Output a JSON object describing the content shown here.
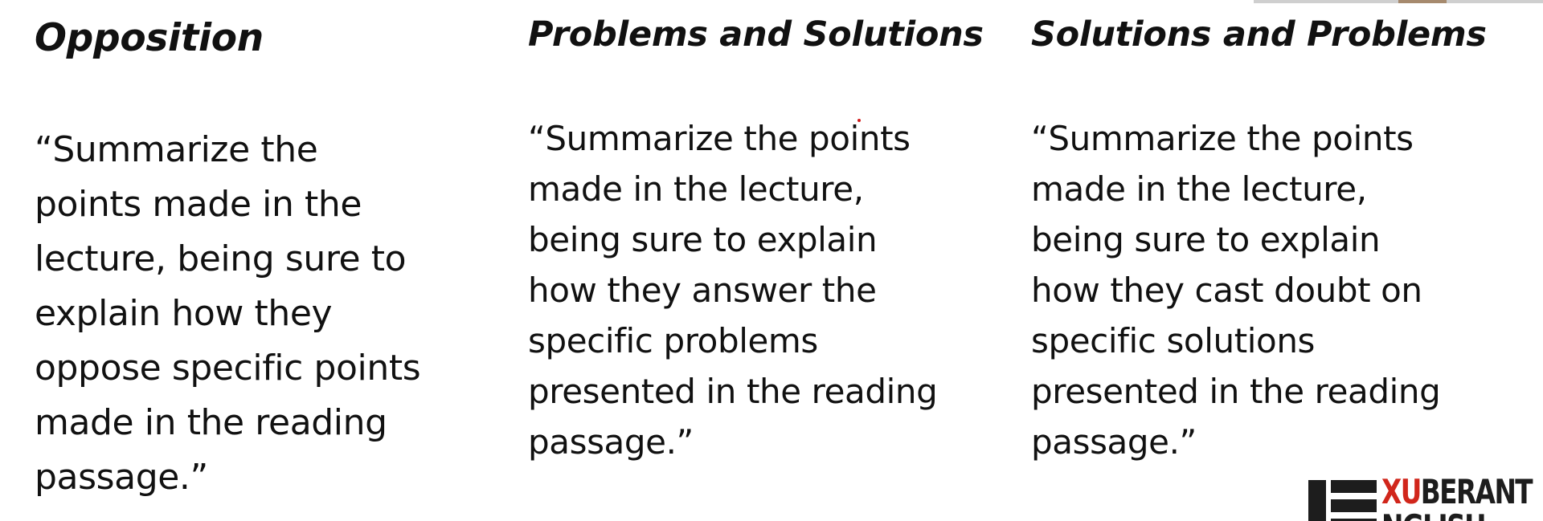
{
  "columns": [
    {
      "title": "Opposition",
      "quote": "“Summarize the\npoints made in the\nlecture, being sure to\nexplain how they\noppose specific points\nmade in the reading\npassage.”"
    },
    {
      "title": "Problems and Solutions",
      "quote": "“Summarize the points\nmade in the lecture,\nbeing sure to explain\nhow they answer the\nspecific problems\npresented in the reading\npassage.”"
    },
    {
      "title": "Solutions and Problems",
      "quote": "“Summarize the points\nmade in the lecture,\nbeing sure to explain\nhow they cast doubt on\nspecific solutions\npresented in the reading\npassage.”"
    }
  ],
  "logo": {
    "accent_text": "XU",
    "main_text": "BERANT",
    "sub_text": "NGLISH",
    "accent_color": "#d1261b",
    "dark_color": "#1d1d1d"
  }
}
